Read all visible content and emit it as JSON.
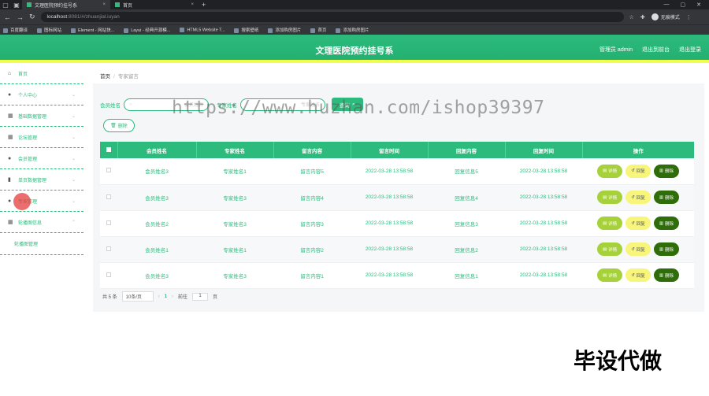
{
  "browser": {
    "tabs": [
      {
        "label": "文理医院预约挂号系",
        "active": true
      },
      {
        "label": "首页",
        "active": false
      }
    ],
    "url_host": "localhost",
    "url_rest": ":8081/#/zhuanjial.iuyan",
    "profile_label": "无痕模式",
    "bookmarks": [
      "百度翻译",
      "图标网站",
      "Element - 网站快...",
      "Layui - 经典开源模...",
      "HTML5 Website T...",
      "搜索壁纸",
      "添加购房图片",
      "首页",
      "添加购房图片"
    ]
  },
  "header": {
    "title": "文理医院预约挂号系",
    "user": "管理员 admin",
    "back_link": "退出到前台",
    "logout_link": "退出登录"
  },
  "sidebar": {
    "items": [
      {
        "label": "首页",
        "icon": "home-icon"
      },
      {
        "label": "个人中心",
        "icon": "user-icon"
      },
      {
        "label": "基础数据管理",
        "icon": "grid-icon"
      },
      {
        "label": "论坛管理",
        "icon": "grid-icon"
      },
      {
        "label": "会员管理",
        "icon": "user-icon"
      },
      {
        "label": "单页数据管理",
        "icon": "chart-icon"
      },
      {
        "label": "专家管理",
        "icon": "user-icon"
      },
      {
        "label": "轮播图信息",
        "icon": "grid-icon"
      }
    ],
    "submenu": "轮播图管理"
  },
  "breadcrumb": {
    "home": "首页",
    "current": "专家留言"
  },
  "search": {
    "label1": "会员姓名",
    "placeholder1": "会员姓名",
    "label2": "专家姓名",
    "placeholder2": "专家姓名",
    "button": "查询"
  },
  "delete_all_label": "删除",
  "table": {
    "headers": [
      "会员姓名",
      "专家姓名",
      "留言内容",
      "留言时间",
      "回复内容",
      "回复时间",
      "操作"
    ],
    "rows": [
      [
        "会员姓名3",
        "专家姓名1",
        "留言内容5",
        "2022-03-28 13:58:58",
        "回复信息5",
        "2022-03-28 13:58:58"
      ],
      [
        "会员姓名3",
        "专家姓名3",
        "留言内容4",
        "2022-03-28 13:58:58",
        "回复信息4",
        "2022-03-28 13:58:58"
      ],
      [
        "会员姓名2",
        "专家姓名3",
        "留言内容3",
        "2022-03-28 13:58:58",
        "回复信息3",
        "2022-03-28 13:58:58"
      ],
      [
        "会员姓名1",
        "专家姓名1",
        "留言内容2",
        "2022-03-28 13:58:58",
        "回复信息2",
        "2022-03-28 13:58:58"
      ],
      [
        "会员姓名3",
        "专家姓名3",
        "留言内容1",
        "2022-03-28 13:58:58",
        "回复信息1",
        "2022-03-28 13:58:58"
      ]
    ],
    "op_view": "详情",
    "op_reply": "回复",
    "op_delete": "删除"
  },
  "pager": {
    "total": "共 5 条",
    "page_size": "10条/页",
    "current_page": "1",
    "goto_label": "前往",
    "goto_value": "1",
    "page_suffix": "页"
  },
  "watermark": "https://www.huzhan.com/ishop39397",
  "stamp": "毕设代做",
  "colors": {
    "primary": "#2dbb7d",
    "accent_bar": "#f0ff4a",
    "view_btn": "#a7d13a",
    "reply_btn": "#f7f57a",
    "delete_btn": "#2f6d0a"
  }
}
